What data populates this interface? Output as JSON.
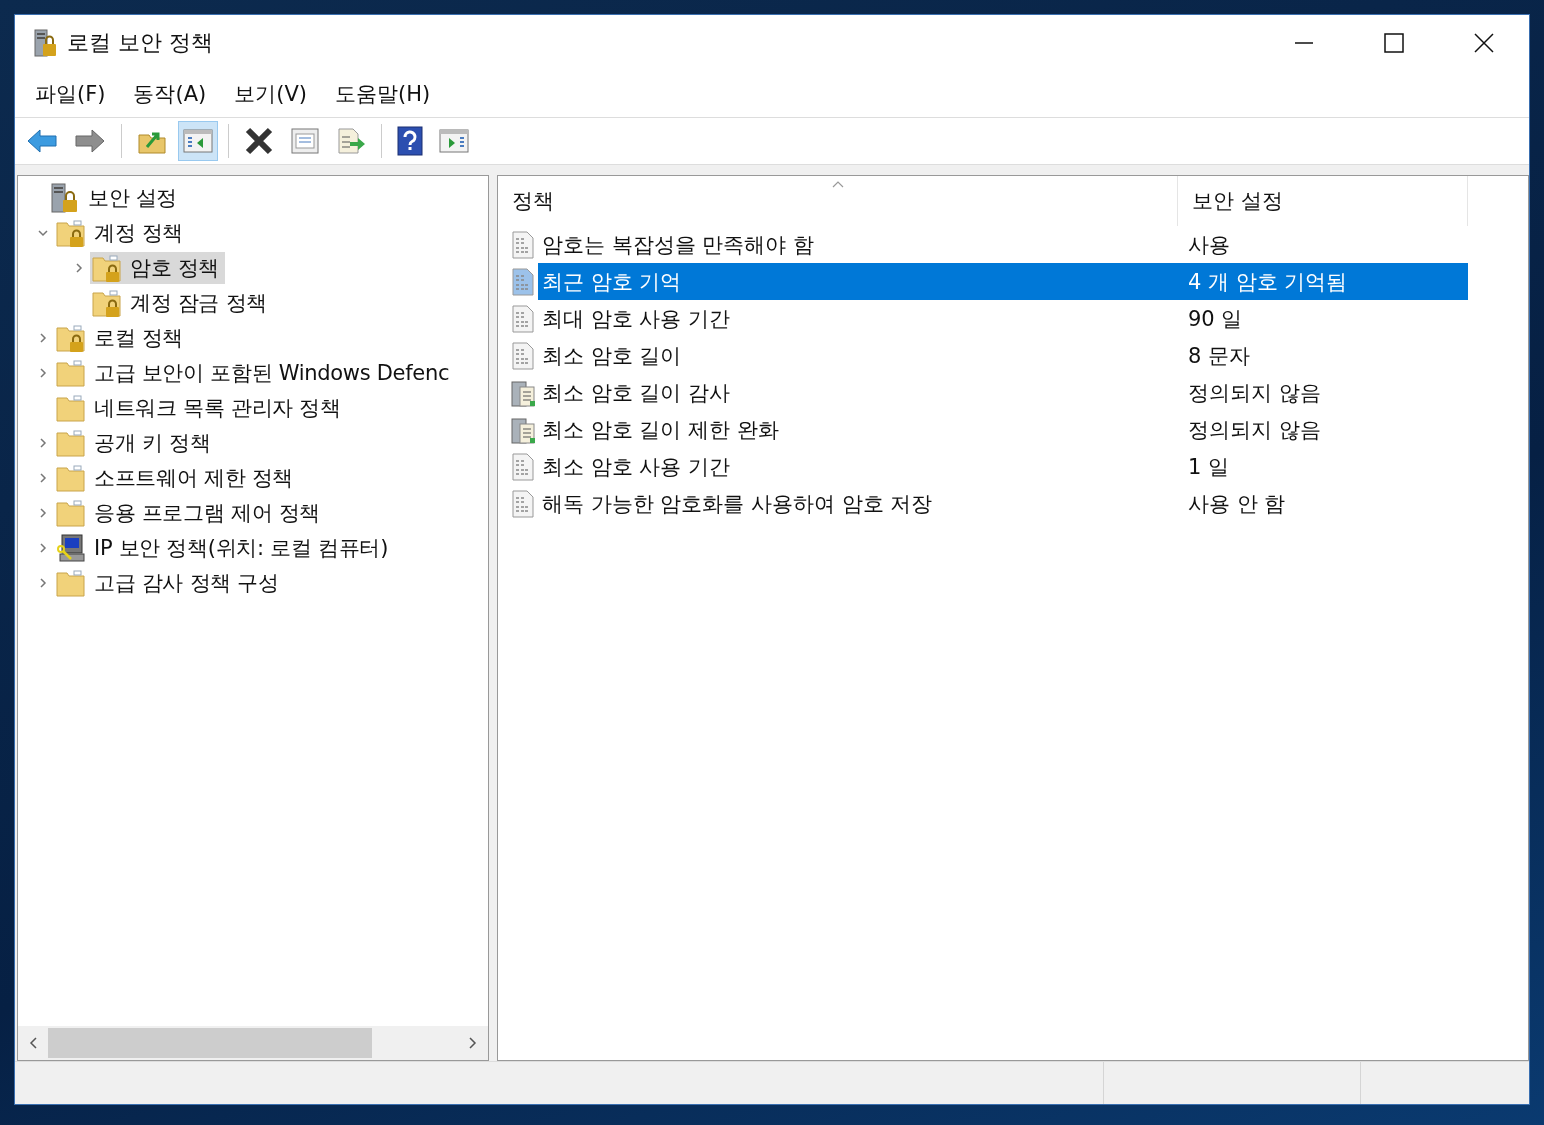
{
  "window": {
    "title": "로컬 보안 정책"
  },
  "menu": [
    {
      "label": "파일(F)"
    },
    {
      "label": "동작(A)"
    },
    {
      "label": "보기(V)"
    },
    {
      "label": "도움말(H)"
    }
  ],
  "toolbar": [
    {
      "kind": "back",
      "pressed": false
    },
    {
      "kind": "forward",
      "pressed": false
    },
    {
      "kind": "separator"
    },
    {
      "kind": "up",
      "pressed": false
    },
    {
      "kind": "tree-toggle",
      "pressed": true
    },
    {
      "kind": "separator"
    },
    {
      "kind": "delete",
      "pressed": false
    },
    {
      "kind": "properties",
      "pressed": false
    },
    {
      "kind": "export",
      "pressed": false
    },
    {
      "kind": "separator"
    },
    {
      "kind": "help",
      "pressed": false
    },
    {
      "kind": "action-pane",
      "pressed": false
    }
  ],
  "tree": [
    {
      "label": "보안 설정",
      "kind": "server-lock",
      "selected": false,
      "children": [
        {
          "label": "계정 정책",
          "kind": "locked-folder",
          "expanded": true,
          "selected": false,
          "children": [
            {
              "label": "암호 정책",
              "kind": "locked-folder",
              "expanded": false,
              "selected": true
            },
            {
              "label": "계정 잠금 정책",
              "kind": "locked-folder",
              "selected": false
            }
          ]
        },
        {
          "label": "로컬 정책",
          "kind": "locked-folder",
          "expanded": false,
          "selected": false
        },
        {
          "label": "고급 보안이 포함된 Windows Defenc",
          "kind": "folder",
          "expanded": false,
          "selected": false
        },
        {
          "label": "네트워크 목록 관리자 정책",
          "kind": "folder",
          "selected": false
        },
        {
          "label": "공개 키 정책",
          "kind": "folder",
          "expanded": false,
          "selected": false
        },
        {
          "label": "소프트웨어 제한 정책",
          "kind": "folder",
          "expanded": false,
          "selected": false
        },
        {
          "label": "응용 프로그램 제어 정책",
          "kind": "folder",
          "expanded": false,
          "selected": false
        },
        {
          "label": "IP 보안 정책(위치: 로컬 컴퓨터)",
          "kind": "ip-security",
          "expanded": false,
          "selected": false
        },
        {
          "label": "고급 감사 정책 구성",
          "kind": "folder",
          "expanded": false,
          "selected": false
        }
      ]
    }
  ],
  "table": {
    "columns": [
      {
        "label": "정책",
        "sorted": true
      },
      {
        "label": "보안 설정",
        "sorted": false
      }
    ],
    "rows": [
      {
        "policy": "암호는 복잡성을 만족해야 함",
        "setting": "사용",
        "kind": "binary",
        "selected": false
      },
      {
        "policy": "최근 암호 기억",
        "setting": "4 개 암호 기억됨",
        "kind": "binary",
        "selected": true
      },
      {
        "policy": "최대 암호 사용 기간",
        "setting": "90 일",
        "kind": "binary",
        "selected": false
      },
      {
        "policy": "최소 암호 길이",
        "setting": "8 문자",
        "kind": "binary",
        "selected": false
      },
      {
        "policy": "최소 암호 길이 감사",
        "setting": "정의되지 않음",
        "kind": "audit",
        "selected": false
      },
      {
        "policy": "최소 암호 길이 제한 완화",
        "setting": "정의되지 않음",
        "kind": "audit",
        "selected": false
      },
      {
        "policy": "최소 암호 사용 기간",
        "setting": "1 일",
        "kind": "binary",
        "selected": false
      },
      {
        "policy": "해독 가능한 암호화를 사용하여 암호 저장",
        "setting": "사용 안 함",
        "kind": "binary",
        "selected": false
      }
    ]
  }
}
